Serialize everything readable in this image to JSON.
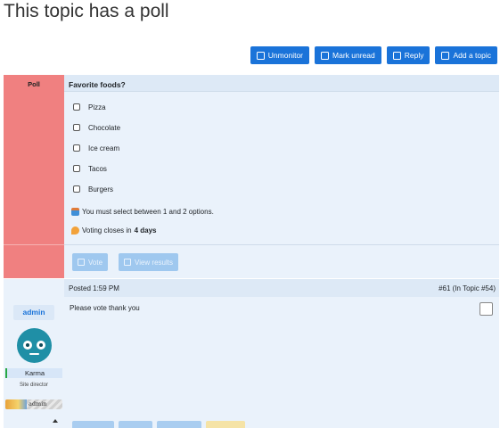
{
  "page": {
    "title": "This topic has a poll"
  },
  "toolbar": [
    {
      "label": "Unmonitor",
      "icon": "unmonitor-icon"
    },
    {
      "label": "Mark unread",
      "icon": "mark-unread-icon"
    },
    {
      "label": "Reply",
      "icon": "reply-icon"
    },
    {
      "label": "Add a topic",
      "icon": "add-topic-icon"
    }
  ],
  "poll": {
    "side_label": "Poll",
    "question": "Favorite foods?",
    "options": [
      "Pizza",
      "Chocolate",
      "Ice cream",
      "Tacos",
      "Burgers"
    ],
    "select_note": "You must select between 1 and 2 options.",
    "closes_prefix": "Voting closes in",
    "closes_value": "4 days",
    "vote_label": "Vote",
    "view_results_label": "View results"
  },
  "post": {
    "posted": "Posted 1:59 PM",
    "ref": "#61 (In Topic #54)",
    "body": "Please vote thank you",
    "author": {
      "username": "admin",
      "karma_label": "Karma",
      "role": "Site director",
      "rank_text": "admin"
    }
  },
  "colors": {
    "primary": "#1a73d9",
    "poll_side": "#f08080",
    "panel_bg": "#eaf2fb",
    "header_bg": "#dde9f6",
    "disabled_button": "#9fc8ef"
  }
}
